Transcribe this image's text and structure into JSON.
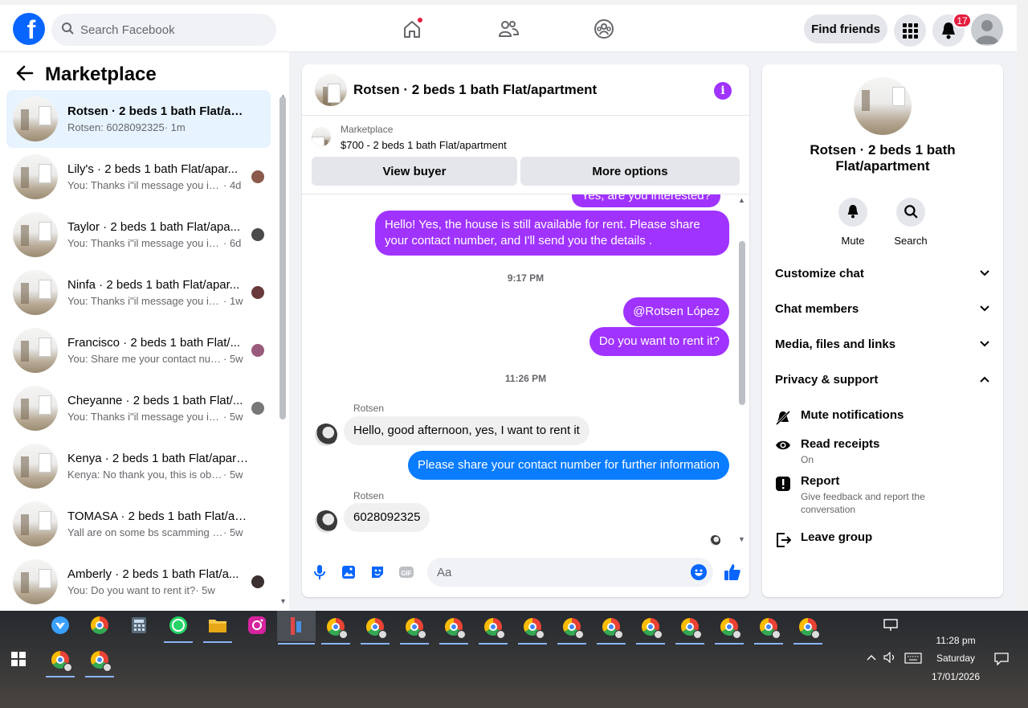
{
  "topbar": {
    "logo": "f",
    "search_placeholder": "Search Facebook",
    "find_friends": "Find friends",
    "notif_count": "17"
  },
  "left": {
    "title": "Marketplace",
    "conversations": [
      {
        "name": "Rotsen · 2 beds 1 bath Flat/apart...",
        "snippet": "Rotsen: 6028092325",
        "time": "· 1m"
      },
      {
        "name": "Lily's · 2 beds 1 bath Flat/apar...",
        "snippet": "You: Thanks i\"il message you in ...",
        "time": "· 4d"
      },
      {
        "name": "Taylor · 2 beds 1 bath Flat/apa...",
        "snippet": "You: Thanks i\"il message you in ...",
        "time": "· 6d"
      },
      {
        "name": "Ninfa · 2 beds 1 bath Flat/apar...",
        "snippet": "You: Thanks i\"il message you in ...",
        "time": "· 1w"
      },
      {
        "name": "Francisco · 2 beds 1 bath Flat/...",
        "snippet": "You: Share me your contact num...",
        "time": "· 5w"
      },
      {
        "name": "Cheyanne · 2 beds 1 bath Flat/...",
        "snippet": "You: Thanks i\"il message you in ...",
        "time": "· 5w"
      },
      {
        "name": "Kenya · 2 beds 1 bath Flat/apart...",
        "snippet": "Kenya: No thank you, this is obvio...",
        "time": "· 5w"
      },
      {
        "name": "TOMASA · 2 beds 1 bath Flat/ap...",
        "snippet": "Yall are on some bs scamming asse...",
        "time": "· 5w"
      },
      {
        "name": "Amberly · 2 beds 1 bath Flat/a...",
        "snippet": "You: Do you want to rent it?",
        "time": "· 5w"
      }
    ]
  },
  "chat": {
    "title": "Rotsen · 2 beds 1 bath Flat/apartment",
    "marketplace_label": "Marketplace",
    "listing": "$700 - 2 beds 1 bath Flat/apartment",
    "view_buyer": "View buyer",
    "more_options": "More options",
    "messages": {
      "partial": "Yes, are you interested?",
      "m1": "Hello! Yes, the house is still available for rent. Please share your contact number, and I'll send you the details .",
      "ts1": "9:17 PM",
      "m2": "@Rotsen López",
      "m3": "Do you want to rent it?",
      "ts2": "11:26 PM",
      "sender1": "Rotsen",
      "m4": "Hello, good afternoon, yes, I want to rent it",
      "m5": "Please share your contact number for further information",
      "sender2": "Rotsen",
      "m6": "6028092325"
    },
    "composer_placeholder": "Aa"
  },
  "right": {
    "title": "Rotsen · 2 beds 1 bath Flat/apartment",
    "mute": "Mute",
    "search": "Search",
    "sections": [
      "Customize chat",
      "Chat members",
      "Media, files and links",
      "Privacy & support"
    ],
    "mute_notifications": "Mute notifications",
    "read_receipts": "Read receipts",
    "read_receipts_state": "On",
    "report": "Report",
    "report_sub": "Give feedback and report the conversation",
    "leave_group": "Leave group"
  },
  "taskbar": {
    "time": "11:28 pm",
    "day": "Saturday",
    "date": "17/01/2026"
  },
  "colors": {
    "accent": "#0866ff",
    "purple_bubble": "#a033ff",
    "blue_bubble": "#0a7cff"
  }
}
